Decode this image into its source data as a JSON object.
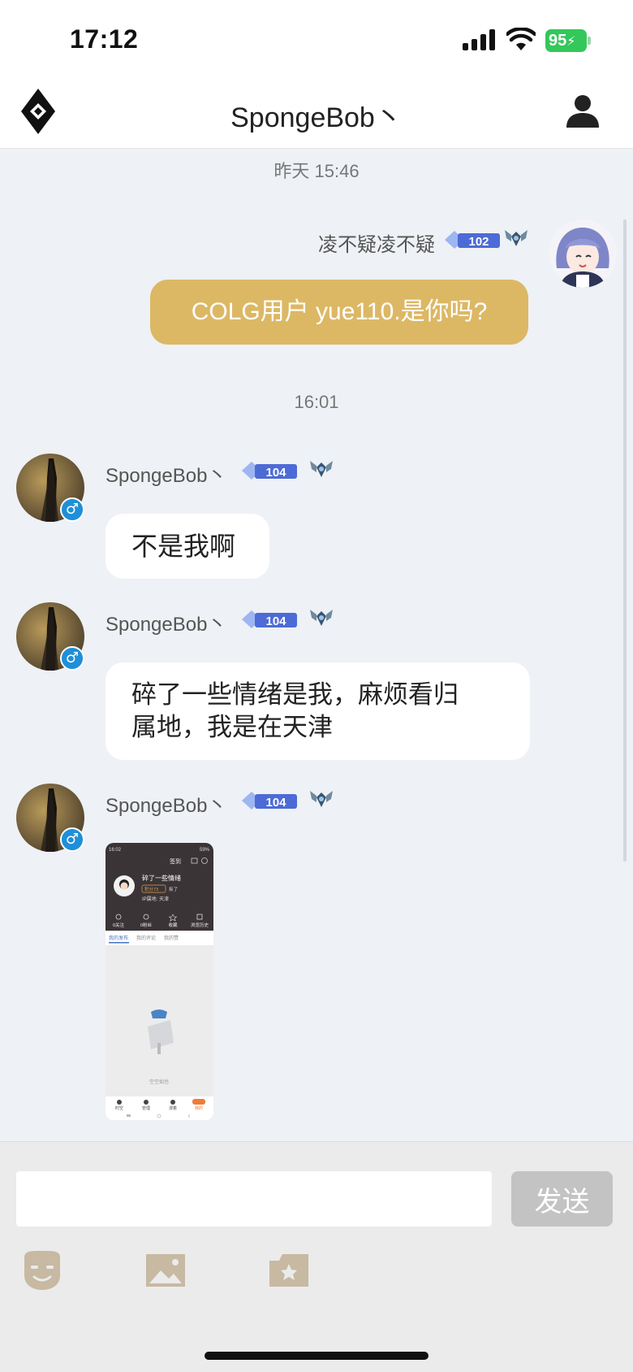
{
  "status_bar": {
    "time": "17:12",
    "battery": "95"
  },
  "header": {
    "title": "SpongeBob丶"
  },
  "messages": {
    "ts1": "昨天 15:46",
    "out1": {
      "sender": "凌不疑凌不疑",
      "level": "102",
      "text": "COLG用户 yue110.是你吗?"
    },
    "ts2": "16:01",
    "in1": {
      "sender": "SpongeBob丶",
      "level": "104",
      "text": "不是我啊"
    },
    "in2": {
      "sender": "SpongeBob丶",
      "level": "104",
      "line1": "碎了一些情绪是我，麻烦看归",
      "line2": "属地，我是在天津"
    },
    "in3": {
      "sender": "SpongeBob丶",
      "level": "104"
    }
  },
  "gender_symbol": "♂",
  "screenshot": {
    "time": "16:02",
    "top_right": "签到",
    "battery": "59%",
    "name": "碎了一些情绪",
    "badge": "积分73",
    "badge_extra": "拆了",
    "ip": "IP属地: 天津",
    "stats": [
      "0关注",
      "0粉丝",
      "收藏",
      "浏览历史"
    ],
    "tabs": [
      "我的发布",
      "我的评论",
      "我的赞"
    ],
    "empty": "空空如也",
    "nav": [
      "时空",
      "管理",
      "漫着",
      "我的"
    ]
  },
  "composer": {
    "placeholder": "",
    "send_label": "发送"
  },
  "colors": {
    "outgoing_bubble": "#dcb865",
    "send_disabled": "#c3c3c3",
    "gender_badge": "#1e8fd8",
    "tool_icon": "#c7b9a2"
  },
  "icons": [
    "logo-icon",
    "profile-icon",
    "emoji-icon",
    "image-icon",
    "gallery-icon"
  ]
}
